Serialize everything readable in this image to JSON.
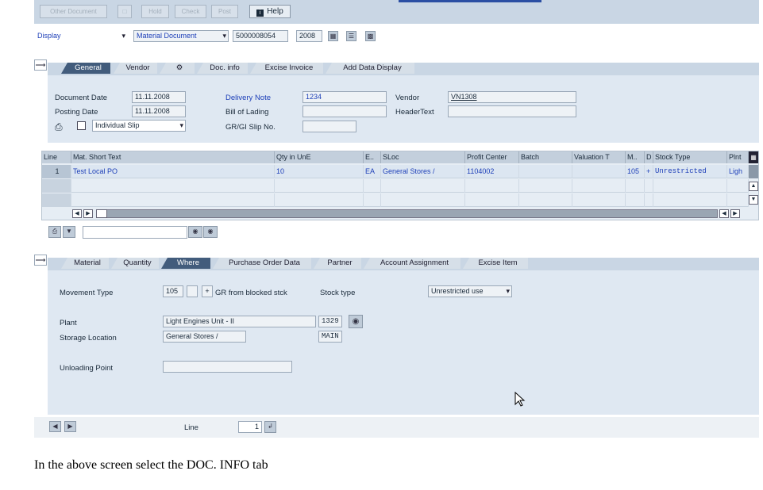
{
  "toolbar": {
    "buttons": [
      "Other Document",
      "",
      "Hold",
      "Check",
      "Post"
    ],
    "help_label": "Help"
  },
  "selection": {
    "action": "Display",
    "doc_type": "Material Document",
    "doc_number": "5000008054",
    "year": "2008"
  },
  "header_tabs": [
    "General",
    "Vendor",
    "",
    "Doc. info",
    "Excise Invoice",
    "Add Data Display"
  ],
  "header": {
    "document_date_label": "Document Date",
    "document_date": "11.11.2008",
    "posting_date_label": "Posting Date",
    "posting_date": "11.11.2008",
    "slip_type": "Individual Slip",
    "delivery_note_label": "Delivery Note",
    "delivery_note": "1234",
    "bill_of_lading_label": "Bill of Lading",
    "bill_of_lading": "",
    "gr_gi_slip_label": "GR/GI Slip No.",
    "gr_gi_slip": "",
    "vendor_label": "Vendor",
    "vendor": "VN1308",
    "header_text_label": "HeaderText",
    "header_text": ""
  },
  "items": {
    "columns": [
      "Line",
      "Mat. Short Text",
      "Qty in UnE",
      "E..",
      "SLoc",
      "Profit Center",
      "Batch",
      "Valuation T",
      "M..",
      "D",
      "Stock Type",
      "Plnt"
    ],
    "rows": [
      {
        "line": "1",
        "text": "Test Local PO",
        "qty": "10",
        "unit": "EA",
        "sloc": "General Stores /",
        "profit_center": "1104002",
        "batch": "",
        "valuation": "",
        "mvt": "105",
        "d": "+",
        "stock_type": "Unrestricted",
        "plant": "Ligh"
      },
      {
        "line": "",
        "text": "",
        "qty": "",
        "unit": "",
        "sloc": "",
        "profit_center": "",
        "batch": "",
        "valuation": "",
        "mvt": "",
        "d": "",
        "stock_type": "",
        "plant": ""
      },
      {
        "line": "",
        "text": "",
        "qty": "",
        "unit": "",
        "sloc": "",
        "profit_center": "",
        "batch": "",
        "valuation": "",
        "mvt": "",
        "d": "",
        "stock_type": "",
        "plant": ""
      }
    ]
  },
  "detail_tabs": [
    "Material",
    "Quantity",
    "Where",
    "Purchase Order Data",
    "Partner",
    "Account Assignment",
    "Excise Item"
  ],
  "detail": {
    "movement_type_label": "Movement Type",
    "movement_type": "105",
    "movement_sign": "+",
    "movement_text": "GR from blocked stck",
    "stock_type_label": "Stock type",
    "stock_type": "Unrestricted use",
    "plant_label": "Plant",
    "plant": "Light Engines Unit - II",
    "plant_code": "1329",
    "storage_location_label": "Storage Location",
    "storage_location": "General Stores /",
    "storage_location_code": "MAIN",
    "unloading_point_label": "Unloading Point",
    "unloading_point": "",
    "line_label": "Line",
    "line_value": "1"
  },
  "caption": "In the above screen select the DOC. INFO tab"
}
